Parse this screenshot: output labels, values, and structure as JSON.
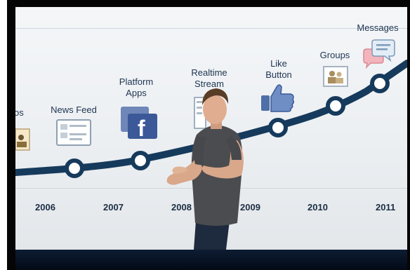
{
  "image": {
    "description_colors": {
      "screen_bg": "#eef1f4",
      "timeline": "#163a5c",
      "text": "#1d3450",
      "facebook_blue": "#3b5998",
      "stage": "#0b1a30"
    },
    "timeline_years": [
      "2006",
      "2007",
      "2008",
      "2009",
      "2010",
      "2011"
    ],
    "features": [
      {
        "label": "os"
      },
      {
        "label": "News Feed"
      },
      {
        "label": "Platform\nApps"
      },
      {
        "label": "Realtime\nStream"
      },
      {
        "label": "Like\nButton"
      },
      {
        "label": "Groups"
      },
      {
        "label": "Messages"
      }
    ],
    "icons": [
      "photos-icon",
      "news-feed-icon",
      "facebook-apps-icon",
      "realtime-stream-icon",
      "like-thumb-icon",
      "groups-icon",
      "messages-icon"
    ]
  }
}
